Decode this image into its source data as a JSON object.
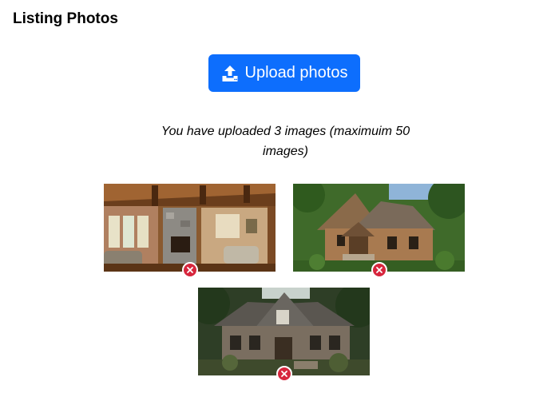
{
  "page": {
    "title": "Listing Photos"
  },
  "upload": {
    "label": "Upload photos",
    "icon": "upload-icon",
    "color": "#0d6efd"
  },
  "status": {
    "text": "You have uploaded 3 images (maximuim 50 images)"
  },
  "photos": [
    {
      "name": "photo-living-room",
      "remove_icon": "remove-icon"
    },
    {
      "name": "photo-stone-cottage",
      "remove_icon": "remove-icon"
    },
    {
      "name": "photo-stone-house",
      "remove_icon": "remove-icon"
    }
  ],
  "colors": {
    "remove": "#d7263d"
  }
}
